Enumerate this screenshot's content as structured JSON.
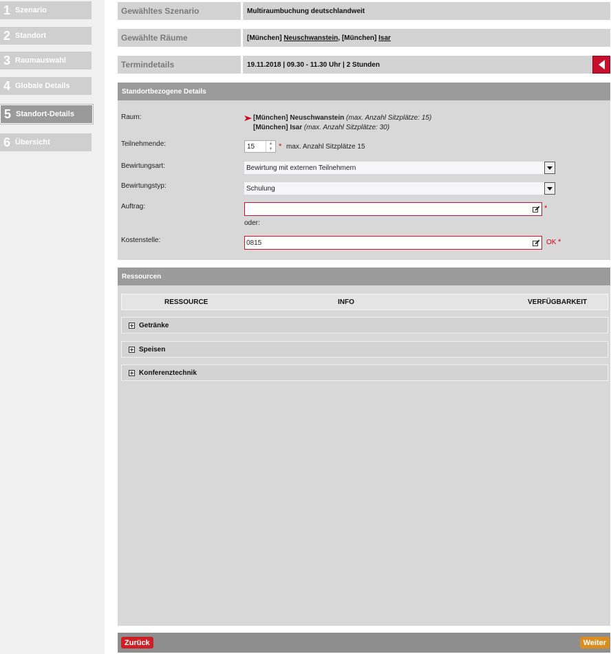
{
  "steps": [
    {
      "num": "1",
      "label": "Szenario"
    },
    {
      "num": "2",
      "label": "Standort"
    },
    {
      "num": "3",
      "label": "Raumauswahl"
    },
    {
      "num": "4",
      "label": "Globale Details"
    },
    {
      "num": "5",
      "label": "Standort-Details"
    },
    {
      "num": "6",
      "label": "Übersicht"
    }
  ],
  "summary": {
    "scenario_label": "Gewähltes Szenario",
    "scenario_value": "Multiraumbuchung deutschlandweit",
    "rooms_label": "Gewählte Räume",
    "room1_prefix": "[München] ",
    "room1_name": "Neuschwanstein",
    "room_sep": ", ",
    "room2_prefix": "[München] ",
    "room2_name": "Isar",
    "termin_label": "Termindetails",
    "termin_value": "19.11.2018 | 09.30 - 11.30 Uhr | 2 Stunden"
  },
  "details": {
    "header": "Standortbezogene Details",
    "raum_label": "Raum:",
    "rooms": [
      {
        "name": "[München] Neuschwanstein",
        "cap": "(max. Anzahl Sitzplätze: 15)"
      },
      {
        "name": "[München] Isar",
        "cap": "(max. Anzahl Sitzplätze: 30)"
      }
    ],
    "teilnehmende_label": "Teilnehmende:",
    "teilnehmende_value": "15",
    "required_mark": "*",
    "max_note": "max. Anzahl Sitzplätze 15",
    "bewirtungsart_label": "Bewirtungsart:",
    "bewirtungsart_value": "Bewirtung mit externen Teilnehmern",
    "bewirtungstyp_label": "Bewirtungstyp:",
    "bewirtungstyp_value": "Schulung",
    "auftrag_label": "Auftrag:",
    "auftrag_value": "",
    "oder": "oder:",
    "kostenstelle_label": "Kostenstelle:",
    "kostenstelle_value": "0815",
    "ok_text": "OK"
  },
  "resources": {
    "header": "Ressourcen",
    "col_resource": "RESSOURCE",
    "col_info": "INFO",
    "col_availability": "VERFÜGBARKEIT",
    "categories": [
      "Getränke",
      "Speisen",
      "Konferenztechnik"
    ]
  },
  "footer": {
    "back_label": "Zurück",
    "next_label": "Weiter"
  },
  "colors": {
    "accent_red": "#c8102e",
    "next_orange": "#d98d1f",
    "back_red": "#cc1f26"
  }
}
